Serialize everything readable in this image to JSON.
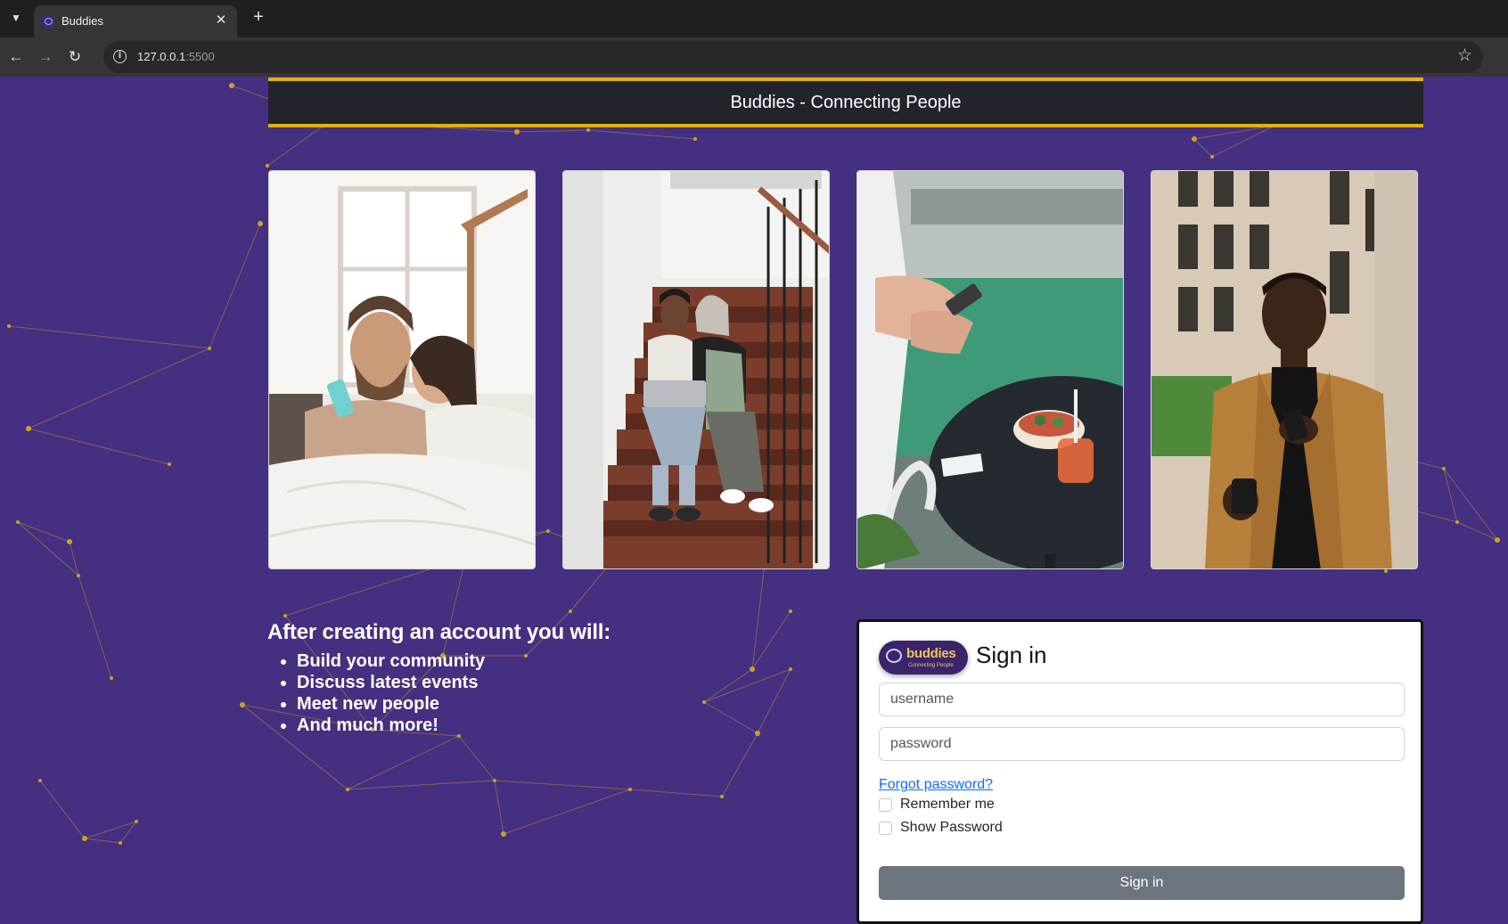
{
  "browser": {
    "tab_title": "Buddies",
    "url_host": "127.0.0.1",
    "url_port": ":5500"
  },
  "header": {
    "title": "Buddies - Connecting People",
    "accent_color": "#e0b20e",
    "bar_color": "#212529"
  },
  "theme": {
    "background": "#452f80",
    "network_color": "#c9a227"
  },
  "gallery": [
    {
      "name": "couple-in-bed-photo"
    },
    {
      "name": "friends-on-stairs-photo"
    },
    {
      "name": "phone-by-table-photo"
    },
    {
      "name": "man-with-phone-photo"
    }
  ],
  "benefits": {
    "heading": "After creating an account you will:",
    "items": [
      "Build your community",
      "Discuss latest events",
      "Meet new people",
      "And much more!"
    ]
  },
  "signin": {
    "logo_text": "buddies",
    "logo_tagline": "Connecting People",
    "title": "Sign in",
    "username_placeholder": "username",
    "password_placeholder": "password",
    "forgot_label": "Forgot password?",
    "remember_label": "Remember me",
    "show_password_label": "Show Password",
    "button_label": "Sign in"
  }
}
